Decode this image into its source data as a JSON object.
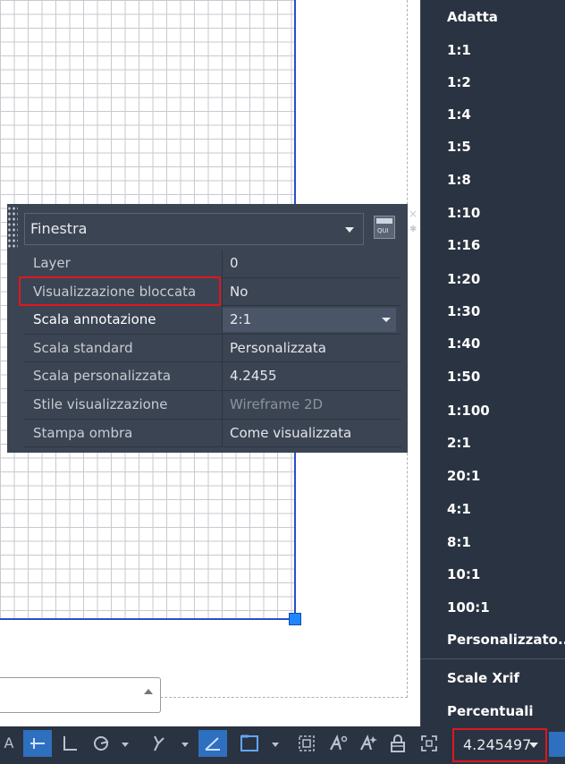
{
  "palette": {
    "selector_value": "Finestra",
    "quick_select_label": "QUI",
    "close_glyph": "×",
    "gear_glyph": "✱",
    "properties": [
      {
        "label": "Layer",
        "value": "0"
      },
      {
        "label": "Visualizzazione bloccata",
        "value": "No"
      },
      {
        "label": "Scala annotazione",
        "value": "2:1"
      },
      {
        "label": "Scala standard",
        "value": "Personalizzata"
      },
      {
        "label": "Scala personalizzata",
        "value": "4.2455"
      },
      {
        "label": "Stile visualizzazione",
        "value": "Wireframe 2D"
      },
      {
        "label": "Stampa ombra",
        "value": "Come visualizzata"
      }
    ]
  },
  "scale_menu": {
    "items": [
      "Adatta",
      "1:1",
      "1:2",
      "1:4",
      "1:5",
      "1:8",
      "1:10",
      "1:16",
      "1:20",
      "1:30",
      "1:40",
      "1:50",
      "1:100",
      "2:1",
      "20:1",
      "4:1",
      "8:1",
      "10:1",
      "100:1",
      "Personalizzato..."
    ],
    "extra_items": [
      "Scale Xrif",
      "Percentuali"
    ]
  },
  "statusbar": {
    "leading_letter": "A",
    "scale_value": "4.245497"
  },
  "colors": {
    "highlight_red": "#e0161e",
    "viewport_blue": "#2b4fc9",
    "palette_bg": "#3b4453",
    "menu_bg": "#2a3341",
    "active_blue": "#2f6fbf"
  },
  "icons": [
    "snap-icon",
    "ortho-icon",
    "polar-icon",
    "osnap-tracking-icon",
    "dynamic-input-icon",
    "selection-cycling-icon",
    "viewport-scale-icon",
    "annotation-visibility-icon",
    "auto-scale-icon",
    "lock-icon",
    "maximize-viewport-icon"
  ]
}
